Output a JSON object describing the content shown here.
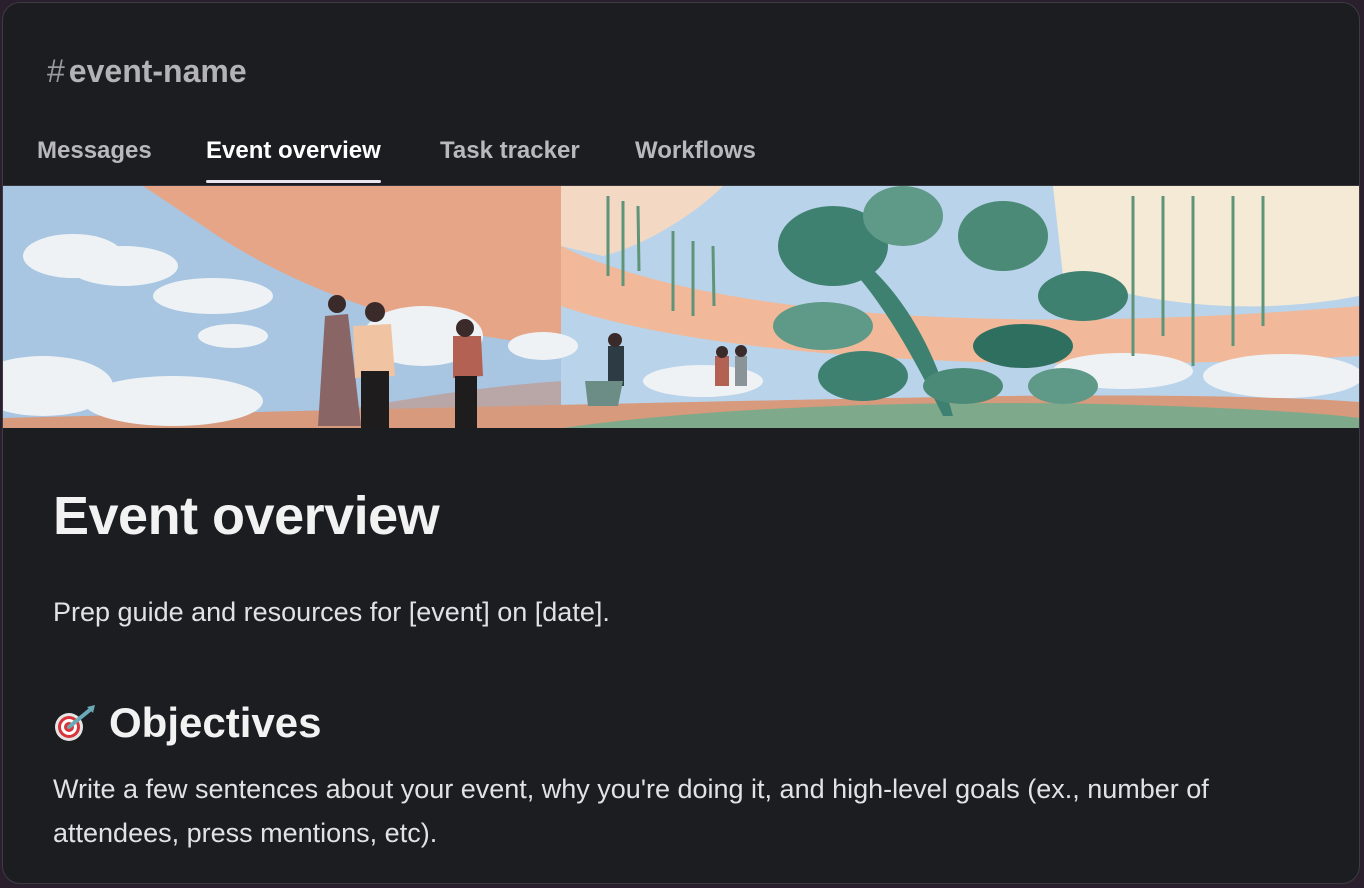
{
  "channel": {
    "hash": "#",
    "name": "event-name"
  },
  "tabs": [
    {
      "label": "Messages"
    },
    {
      "label": "Event overview",
      "active": true
    },
    {
      "label": "Task tracker"
    },
    {
      "label": "Workflows"
    }
  ],
  "page": {
    "title": "Event overview",
    "subtitle": "Prep guide and resources for [event] on [date].",
    "objectives": {
      "icon": "direct-hit-target-icon",
      "heading": "Objectives",
      "body": "Write a few sentences about your event, why you're doing it, and high-level goals (ex., number of attendees, press mentions, etc)."
    }
  },
  "colors": {
    "background": "#1c1d21",
    "tab_active": "#ffffff",
    "tab_inactive": "#b9b9bd",
    "text": "#e2e2e4"
  }
}
